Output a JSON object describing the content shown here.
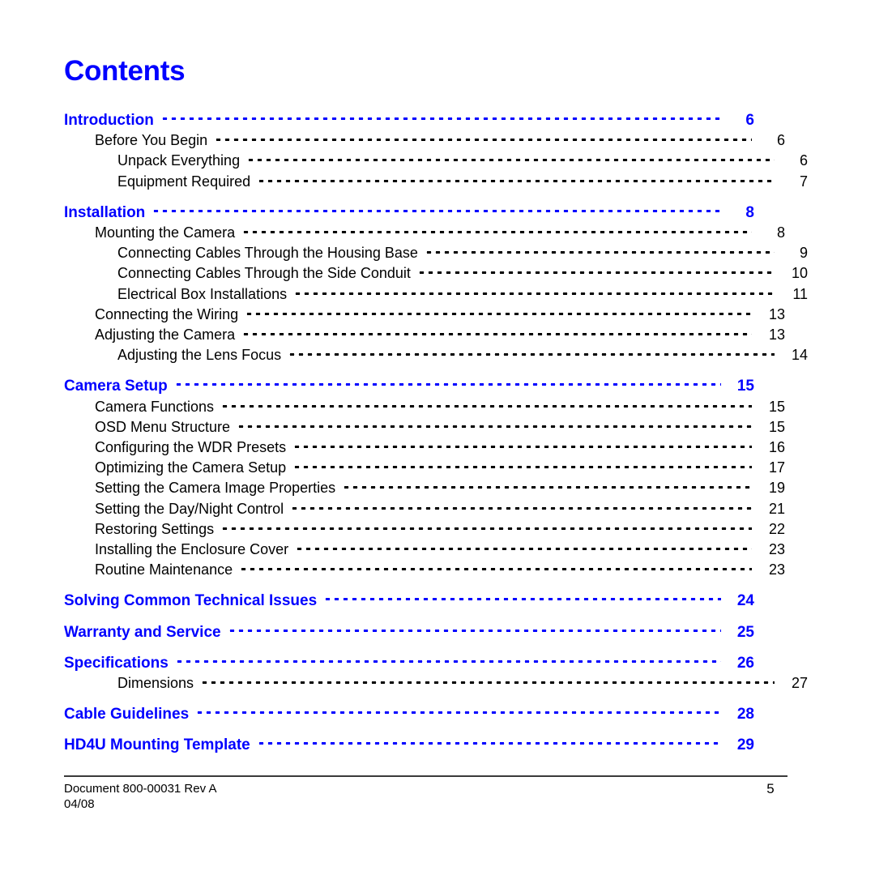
{
  "document": {
    "title": "Contents",
    "accent_color": "#0000ff",
    "text_color": "#000000",
    "background_color": "#ffffff"
  },
  "toc": {
    "entries": [
      {
        "label": "Introduction",
        "page": "6",
        "level": 1
      },
      {
        "label": "Before You Begin",
        "page": "6",
        "level": 2
      },
      {
        "label": "Unpack Everything",
        "page": "6",
        "level": 3
      },
      {
        "label": "Equipment Required",
        "page": "7",
        "level": 3
      },
      {
        "label": "Installation",
        "page": "8",
        "level": 1
      },
      {
        "label": "Mounting the Camera",
        "page": "8",
        "level": 2
      },
      {
        "label": "Connecting Cables Through the Housing Base",
        "page": "9",
        "level": 3
      },
      {
        "label": "Connecting Cables Through the Side Conduit",
        "page": "10",
        "level": 3
      },
      {
        "label": "Electrical Box Installations",
        "page": "11",
        "level": 3
      },
      {
        "label": "Connecting the Wiring",
        "page": "13",
        "level": 2
      },
      {
        "label": "Adjusting the Camera",
        "page": "13",
        "level": 2
      },
      {
        "label": "Adjusting the Lens Focus",
        "page": "14",
        "level": 3
      },
      {
        "label": "Camera Setup",
        "page": "15",
        "level": 1
      },
      {
        "label": "Camera Functions",
        "page": "15",
        "level": 2
      },
      {
        "label": "OSD Menu Structure",
        "page": "15",
        "level": 2
      },
      {
        "label": "Configuring the WDR Presets",
        "page": "16",
        "level": 2
      },
      {
        "label": "Optimizing the Camera Setup",
        "page": "17",
        "level": 2
      },
      {
        "label": "Setting the Camera Image Properties",
        "page": "19",
        "level": 2
      },
      {
        "label": "Setting the Day/Night Control",
        "page": "21",
        "level": 2
      },
      {
        "label": "Restoring Settings",
        "page": "22",
        "level": 2
      },
      {
        "label": "Installing the Enclosure Cover",
        "page": "23",
        "level": 2
      },
      {
        "label": "Routine Maintenance",
        "page": "23",
        "level": 2
      },
      {
        "label": "Solving Common Technical Issues",
        "page": "24",
        "level": 1
      },
      {
        "label": "Warranty and Service",
        "page": "25",
        "level": 1
      },
      {
        "label": "Specifications",
        "page": "26",
        "level": 1
      },
      {
        "label": "Dimensions",
        "page": "27",
        "level": 3
      },
      {
        "label": "Cable Guidelines",
        "page": "28",
        "level": 1
      },
      {
        "label": "HD4U Mounting Template",
        "page": "29",
        "level": 1
      }
    ]
  },
  "footer": {
    "document_id": "Document 800-00031 Rev A",
    "date": "04/08",
    "page_number": "5"
  }
}
